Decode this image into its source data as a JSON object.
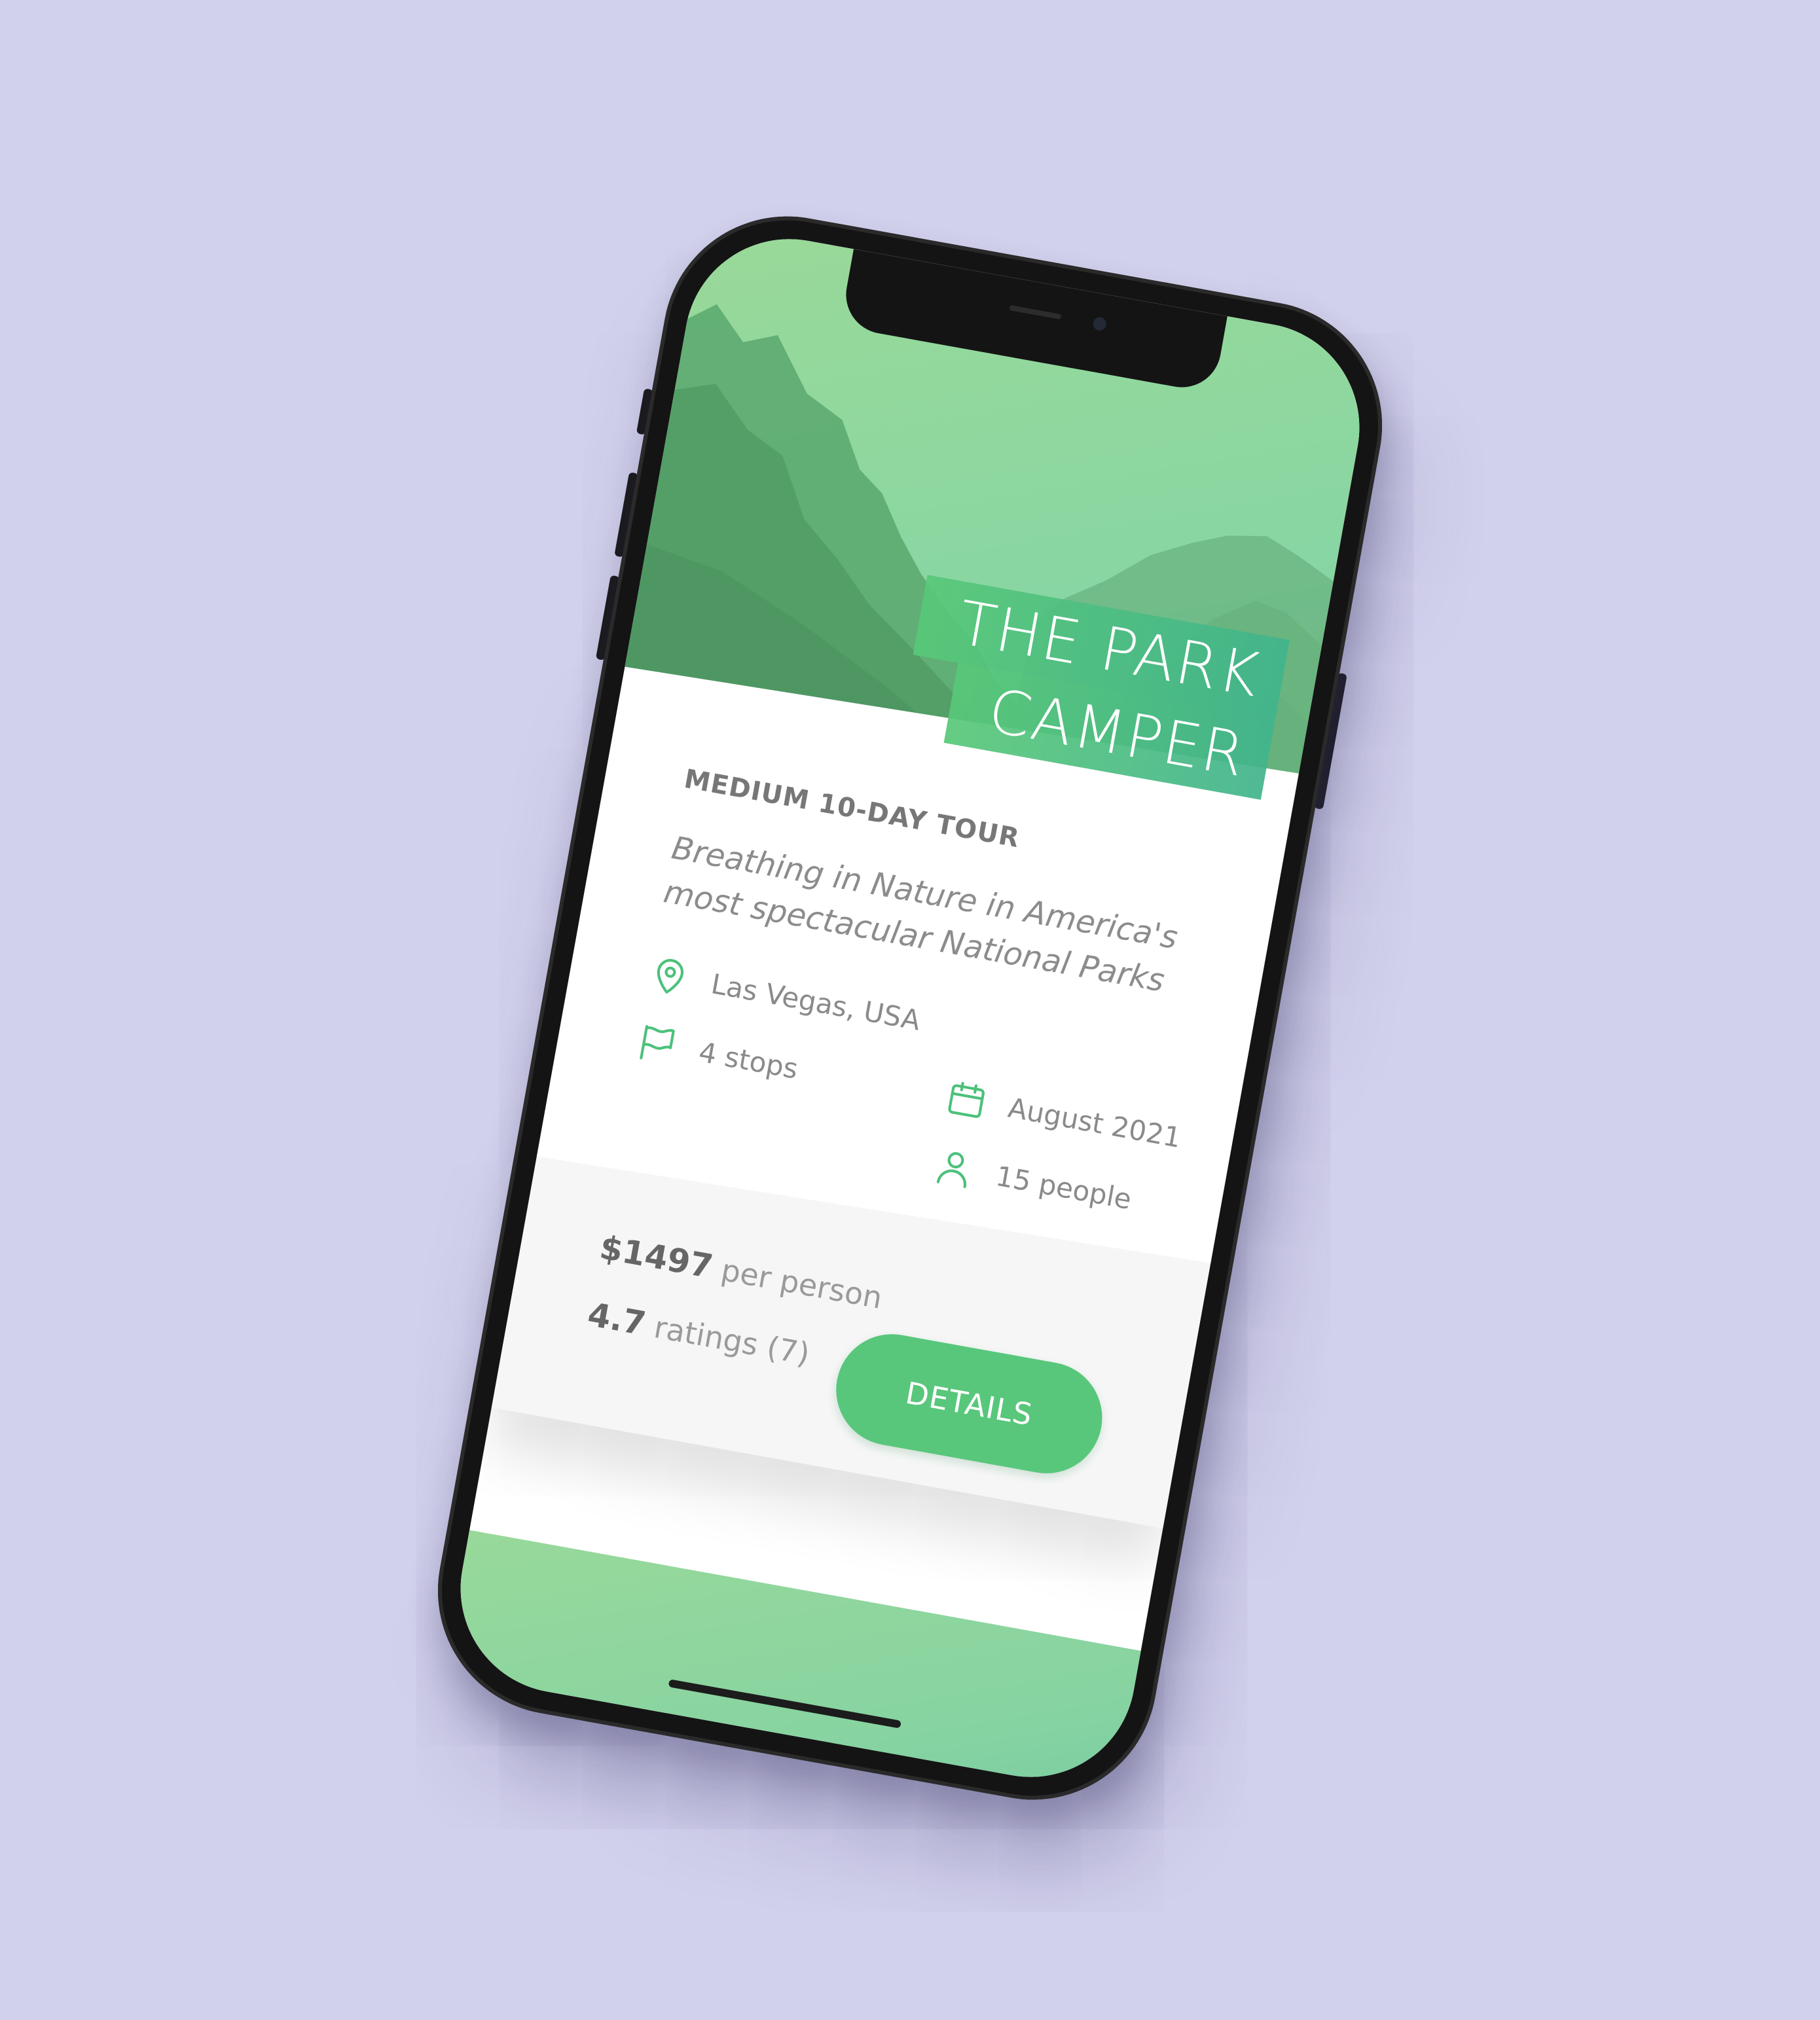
{
  "card": {
    "title_line1": "THE PARK",
    "title_line2": "CAMPER",
    "subtitle": "MEDIUM 10-DAY TOUR",
    "description": "Breathing in Nature in America's most spectacular National Parks",
    "location": "Las Vegas, USA",
    "stops": "4 stops",
    "date": "August 2021",
    "people": "15 people",
    "price_value": "$1497",
    "price_unit": "per person",
    "rating_value": "4.7",
    "rating_label": "ratings (7)",
    "cta_label": "DETAILS"
  },
  "icons": {
    "location": "map-pin-icon",
    "stops": "flag-icon",
    "date": "calendar-icon",
    "people": "user-icon"
  },
  "colors": {
    "background": "#d2d1ec",
    "accent_green": "#58c77b",
    "icon_green": "#4cc17a",
    "footer_bg": "#f6f6f6"
  }
}
